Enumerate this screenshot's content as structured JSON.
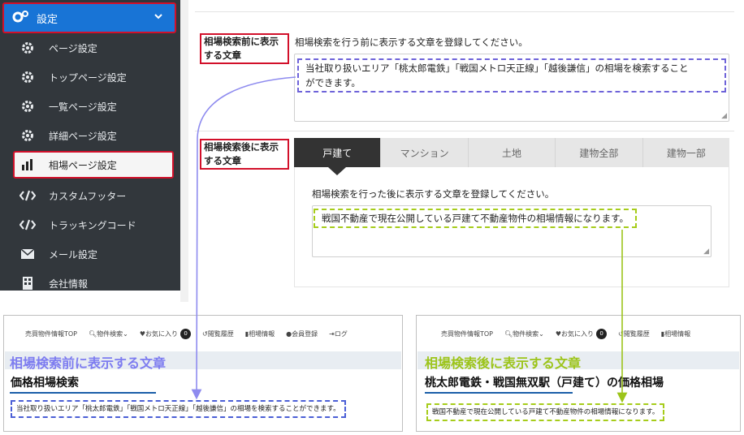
{
  "sidebar": {
    "header": "設定",
    "items": [
      {
        "label": "ページ設定",
        "icon": "gear-icon"
      },
      {
        "label": "トップページ設定",
        "icon": "gear-icon"
      },
      {
        "label": "一覧ページ設定",
        "icon": "gear-icon"
      },
      {
        "label": "詳細ページ設定",
        "icon": "gear-icon"
      },
      {
        "label": "相場ページ設定",
        "icon": "bar-chart-icon"
      },
      {
        "label": "カスタムフッター",
        "icon": "code-icon"
      },
      {
        "label": "トラッキングコード",
        "icon": "code-icon"
      },
      {
        "label": "メール設定",
        "icon": "envelope-icon"
      },
      {
        "label": "会社情報",
        "icon": "building-icon"
      }
    ]
  },
  "before": {
    "label_line1": "相場検索前に表示",
    "label_line2": "する文章",
    "description": "相場検索を行う前に表示する文章を登録してください。",
    "value_line1": "当社取り扱いエリア「桃太郎電鉄」「戦国メトロ天正線」「越後謙信」の相場を検索すること",
    "value_line2": "ができます。"
  },
  "after": {
    "label_line1": "相場検索後に表示",
    "label_line2": "する文章",
    "tabs": [
      "戸建て",
      "マンション",
      "土地",
      "建物全部",
      "建物一部"
    ],
    "description": "相場検索を行った後に表示する文章を登録してください。",
    "value": "戦国不動産で現在公開している戸建て不動産物件の相場情報になります。"
  },
  "preview_left": {
    "nav": [
      "売買物件情報TOP",
      "物件検索",
      "お気に入り",
      "閲覧履歴",
      "相場情報",
      "会員登録",
      "ログ"
    ],
    "badge": "0",
    "band_title": "相場検索前に表示する文章",
    "heading": "価格相場検索",
    "text": "当社取り扱いエリア「桃太郎電鉄」「戦国メトロ天正線」「越後謙信」の相場を検索することができます。"
  },
  "preview_right": {
    "nav": [
      "売買物件情報TOP",
      "物件検索",
      "お気に入り",
      "閲覧履歴",
      "相場情報"
    ],
    "badge": "0",
    "band_title": "相場検索後に表示する文章",
    "heading": "桃太郎電鉄・戦国無双駅（戸建て）の価格相場",
    "text": "戦国不動産で現在公開している戸建て不動産物件の相場情報になります。"
  },
  "colors": {
    "sidebar_bg": "#32373c",
    "accent_blue": "#1874d6",
    "highlight_red": "#d2102a",
    "purple_title": "#7d7cf0",
    "green_title": "#9cc41a",
    "arrow_blue": "#8e8bef",
    "arrow_green": "#9cc41a"
  }
}
